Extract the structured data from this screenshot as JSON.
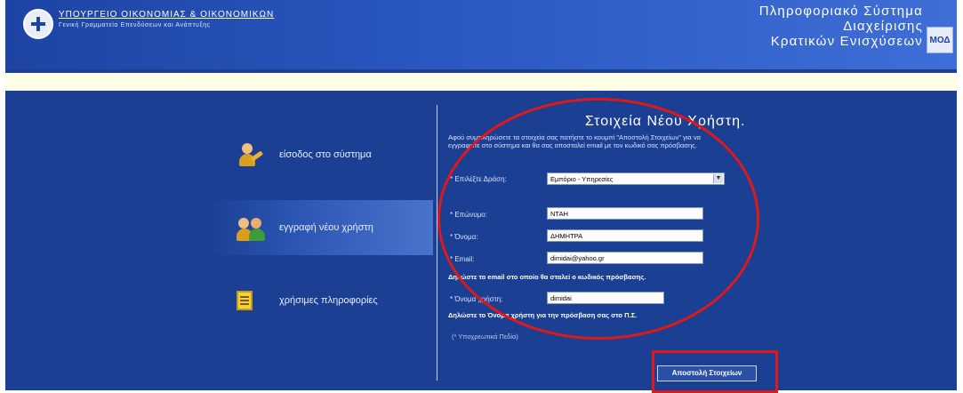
{
  "header": {
    "ministry": "ΥΠΟΥΡΓΕΙΟ ΟΙΚΟΝΟΜΙΑΣ & ΟΙΚΟΝΟΜΙΚΩΝ",
    "ministry_sub": "Γενική Γραμματεία Επενδύσεων και Ανάπτυξης",
    "system_title_line1": "Πληροφοριακό Σύστημα",
    "system_title_line2": "Διαχείρισης",
    "system_title_line3": "Κρατικών Ενισχύσεων",
    "logo_badge": "ΜΟΔ"
  },
  "menu": {
    "items": [
      {
        "label": "είσοδος στο σύστημα",
        "icon": "user-key-icon"
      },
      {
        "label": "εγγραφή νέου χρήστη",
        "icon": "users-icon",
        "active": true
      },
      {
        "label": "χρήσιμες πληροφορίες",
        "icon": "note-icon"
      }
    ]
  },
  "form": {
    "title": "Στοιχεία Νέου Χρήστη.",
    "intro": "Αφού συμπληρώσετε τα στοιχεία σας πατήστε το κουμπί \"Αποστολή Στοιχείων\" για να εγγραφείτε στο σύστημα και θα σας αποσταλεί email με τον κωδικό σας πρόσβασης.",
    "role_label": "* Επιλέξτε Δράση:",
    "role_value": "Εμπόριο - Υπηρεσίες",
    "surname_label": "* Επώνυμο:",
    "surname_value": "ΝΤΑΗ",
    "name_label": "* Όνομα:",
    "name_value": "ΔΗΜΗΤΡΑ",
    "email_label": "* Email:",
    "email_value": "dimidai@yahoo.gr",
    "email_note": "Δηλώστε το email στο οποίο θα σταλεί ο κωδικός πρόσβασης.",
    "username_label": "* Όνομα χρήστη:",
    "username_value": "dimidai",
    "username_note": "Δηλώστε το Όνομα χρήστη για την πρόσβαση σας στο Π.Σ.",
    "mandatory_note": "(* Υποχρεωτικά Πεδία)",
    "submit_label": "Αποστολή Στοιχείων"
  },
  "colors": {
    "background": "#1a3f93",
    "header": "#2a58c0",
    "highlight_red": "#e01818"
  }
}
